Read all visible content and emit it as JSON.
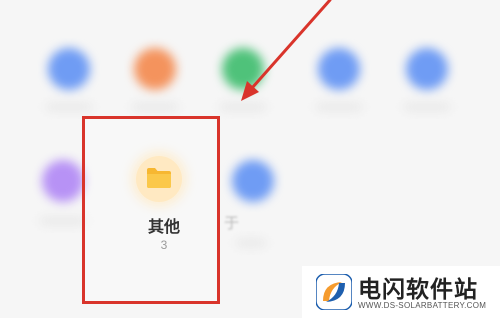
{
  "grid_row1": [
    {
      "name": "app-icon-1",
      "color": "#6f9cf4"
    },
    {
      "name": "app-icon-2",
      "color": "#f4935d"
    },
    {
      "name": "app-icon-3",
      "color": "#4fc27a"
    },
    {
      "name": "app-icon-4",
      "color": "#6f9cf4"
    },
    {
      "name": "app-icon-5",
      "color": "#6f9cf4"
    }
  ],
  "grid_row2": [
    {
      "name": "app-icon-6",
      "color": "#b792f5"
    },
    {
      "name": "app-icon-7",
      "color": "#6f9cf4"
    }
  ],
  "highlighted_item": {
    "icon": "folder-icon",
    "label": "其他",
    "count": "3",
    "highlight_color": "#d9342b",
    "icon_color": "#f7b731"
  },
  "partial_text": "于",
  "annotation": {
    "arrow_color": "#d9342b"
  },
  "watermark": {
    "name": "电闪软件站",
    "domain": "WWW.DS-SOLARBATTERY.COM",
    "logo_colors": [
      "#f59b2e",
      "#1e5fae"
    ]
  }
}
